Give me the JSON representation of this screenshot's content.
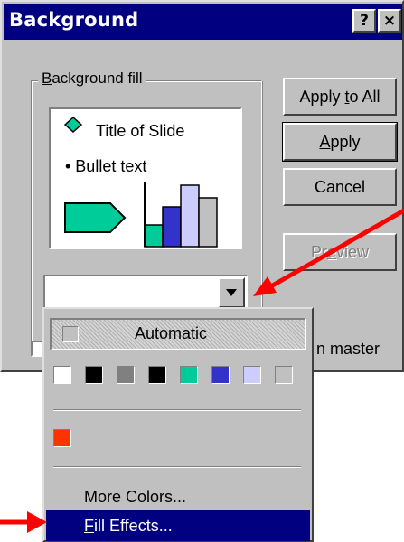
{
  "dialog": {
    "title": "Background",
    "help_label": "?",
    "close_label": "×"
  },
  "background_fill": {
    "label_mnemonic": "B",
    "label_rest": "ackground fill",
    "preview": {
      "title_text": "Title of Slide",
      "bullet_text": "• Bullet text",
      "chart_colors": [
        "#00cc99",
        "#3333cc",
        "#ccccff",
        "#c0c0c0"
      ]
    },
    "color_combo_value": ""
  },
  "buttons": {
    "apply_to_all": {
      "pre": "Apply ",
      "mnemonic": "t",
      "post": "o All"
    },
    "apply": {
      "pre": "",
      "mnemonic": "A",
      "post": "pply"
    },
    "cancel": "Cancel",
    "preview": {
      "pre": "Pr",
      "mnemonic": "e",
      "post": "view"
    }
  },
  "omit_master": {
    "checked": false,
    "label_visible_fragment": "n master"
  },
  "color_menu": {
    "automatic_label": "Automatic",
    "scheme_colors": [
      "#ffffff",
      "#000000",
      "#808080",
      "#000000",
      "#00cc99",
      "#3333cc",
      "#ccccff",
      "#c0c0c0"
    ],
    "recent_colors": [
      "#ff3300"
    ],
    "more_colors_label": "More Colors...",
    "fill_effects": {
      "mnemonic": "F",
      "rest": "ill Effects..."
    },
    "selected_item": "fill_effects"
  },
  "annotations": {
    "arrow_color": "#ff0000"
  }
}
